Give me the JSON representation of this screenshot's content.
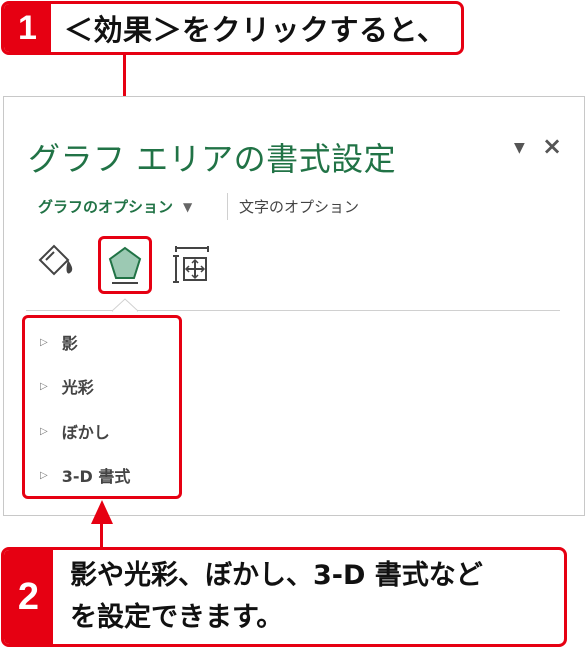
{
  "callout1": {
    "number": "1",
    "text": "＜効果＞をクリックすると、"
  },
  "callout2": {
    "number": "2",
    "line1": "影や光彩、ぼかし、3-D 書式など",
    "line2": "を設定できます。"
  },
  "pane": {
    "title": "グラフ エリアの書式設定",
    "menu_icon": "triangle-down",
    "close_icon": "close",
    "tabs": {
      "graph_options": "グラフのオプション",
      "graph_dropdown_icon": "triangle-down",
      "text_options": "文字のオプション"
    },
    "icons": [
      "fill-line-icon",
      "effects-icon",
      "size-properties-icon"
    ],
    "sections": [
      "影",
      "光彩",
      "ぼかし",
      "3-D 書式"
    ]
  },
  "colors": {
    "accent_red": "#e60012",
    "excel_green": "#217346"
  }
}
